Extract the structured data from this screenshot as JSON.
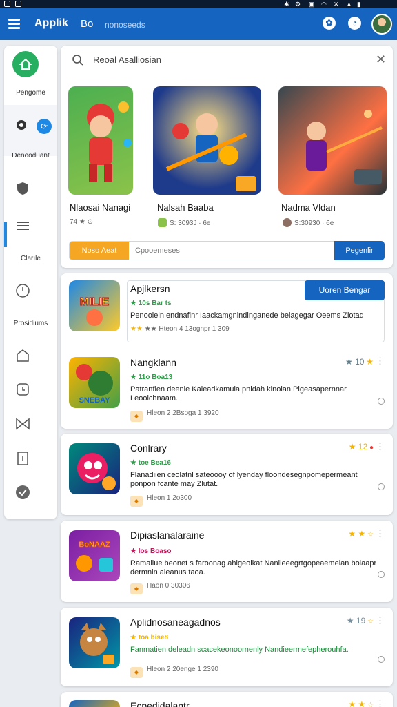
{
  "statusbar": {
    "time": ""
  },
  "appbar": {
    "title": "Applik",
    "tab": "Bo",
    "subtitle": "nonoseeds"
  },
  "sidebar": {
    "labels": {
      "first": "Pengome",
      "second": "Denooduant",
      "third": "Clarıle",
      "fourth": "Prosidiums"
    }
  },
  "search": {
    "placeholder": "Reoal Asalliosian"
  },
  "featured": [
    {
      "name": "Nlaosai Nanagi",
      "meta": "74 ★ ⊙"
    },
    {
      "name": "Nalsah Baaba",
      "meta": "S: 3093J · 6e"
    },
    {
      "name": "Nadma Vldan",
      "meta": "S:30930 · 6e"
    }
  ],
  "filter": {
    "chip": "Noso Aeat",
    "placeholder": "Cpooemeses",
    "button": "Pegenlir"
  },
  "apps": [
    {
      "title": "Apjlkersn",
      "sub": "★ 10s Bar ts",
      "desc": "Penoolein endnafinr Iaackamgnindinganede belagegar Oeems Zlotad",
      "meta": "★★ Hteon 4 13ognpr 1 309",
      "icon_text": "MILIE",
      "rating": "",
      "button": "Uoren Bengar"
    },
    {
      "title": "Nangklann",
      "sub": "★ 11o Boa13",
      "desc": "Patranflen deenle Kaleadkamula pnidah klnolan Plgeasapernnar Leooichnaam.",
      "meta": "Hleon 2 2Bsoga 1 3920",
      "icon_text": "SNEBAY",
      "rating": "★ 10",
      "button": ""
    },
    {
      "title": "Conlrary",
      "sub": "★ toe Bea16",
      "desc": "Flanadiien ceolatnl sateoooy of lyenday floondesegnpomepermeant ponpon fcante may Zlutat.",
      "meta": "Hleon 1 2o300",
      "icon_text": "",
      "rating": "★ 12",
      "button": ""
    },
    {
      "title": "Dipiaslanalaraine",
      "sub": "★ los Boaso",
      "desc": "Ramaliue beonet s faroonag ahlgeolkat Nanlieeegrtgopeaemelan bolaapr dermnin aleanus taoa.",
      "meta": "Haon 0 30306",
      "icon_text": "BoNAAZ",
      "rating": "★ ★",
      "button": ""
    },
    {
      "title": "Aplidnosaneagadnos",
      "sub": "★ toa bise8",
      "desc": "Fanmatien deleadn scacekeonoornenly Nandieermefepherouhfa.",
      "meta": "Hleon 2 20enge 1 2390",
      "icon_text": "",
      "rating": "★ 19",
      "button": ""
    },
    {
      "title": "Ecpedidalantr",
      "sub": "",
      "desc": "",
      "meta": "",
      "icon_text": "",
      "rating": "",
      "button": ""
    }
  ]
}
